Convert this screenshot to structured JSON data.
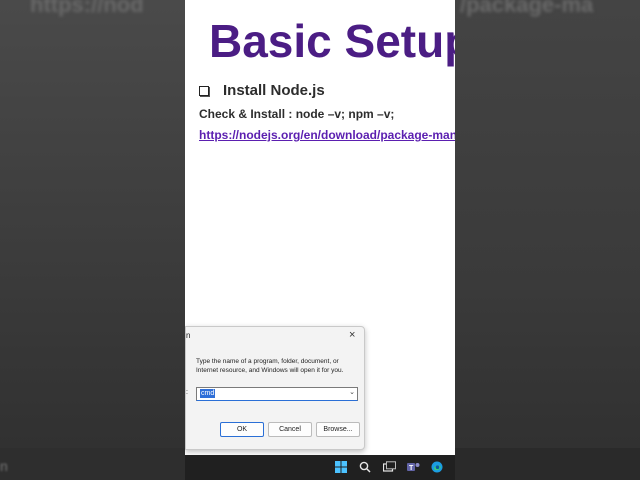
{
  "background": {
    "left_blur_text": "https://nod",
    "right_blur_text": "/package-ma",
    "bottom_left_text": "n"
  },
  "slide": {
    "title": "Basic Setup",
    "bullet": "Install Node.js",
    "check_line": "Check & Install : node –v; npm –v;",
    "link": "https://nodejs.org/en/download/package-manager"
  },
  "run_dialog": {
    "title": "n",
    "close_glyph": "×",
    "description": "Type the name of a program, folder, document, or Internet resource, and Windows will open it for you.",
    "open_label": ":",
    "input_value": "cmd",
    "ok_label": "OK",
    "cancel_label": "Cancel",
    "browse_label": "Browse..."
  },
  "taskbar": {
    "icons": [
      "windows-start-icon",
      "search-icon",
      "task-view-icon",
      "teams-icon",
      "edge-icon"
    ]
  },
  "colors": {
    "title": "#4b1d84",
    "link": "#5b1fb0",
    "accent": "#2f6fd8",
    "taskbar": "#202020"
  }
}
